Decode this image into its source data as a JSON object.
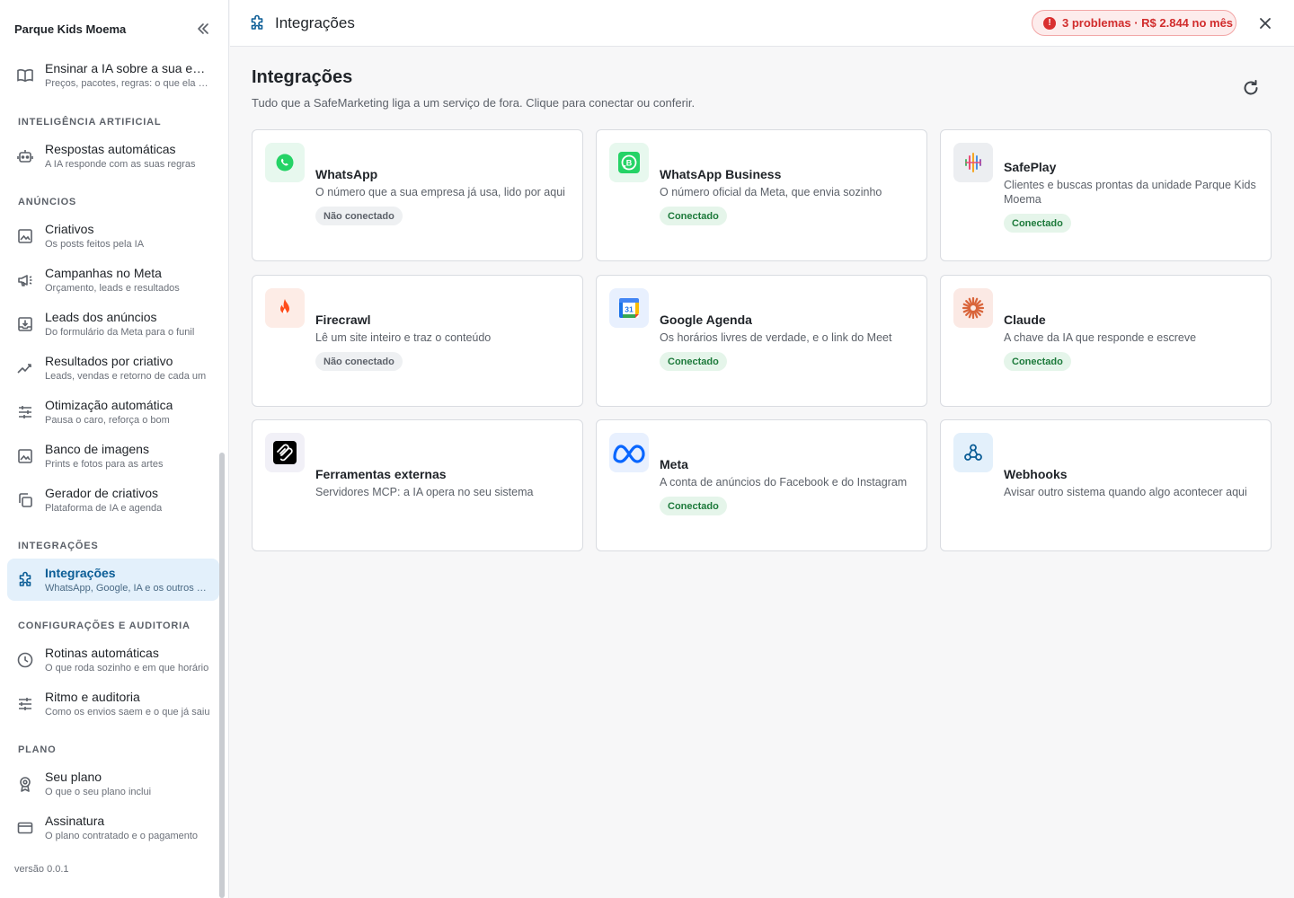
{
  "sidebar": {
    "org_name": "Parque Kids Moema",
    "top_item": {
      "label": "Ensinar a IA sobre a sua empresa",
      "desc": "Preços, pacotes, regras: o que ela precisa saber"
    },
    "sections": [
      {
        "title": "Inteligência artificial"
      },
      {
        "title": "Anúncios"
      },
      {
        "title": "Integrações"
      },
      {
        "title": "Configurações e auditoria"
      },
      {
        "title": "Plano"
      }
    ],
    "items": [
      {
        "label": "Respostas automáticas",
        "desc": "A IA responde com as suas regras"
      },
      {
        "label": "Criativos",
        "desc": "Os posts feitos pela IA"
      },
      {
        "label": "Campanhas no Meta",
        "desc": "Orçamento, leads e resultados"
      },
      {
        "label": "Leads dos anúncios",
        "desc": "Do formulário da Meta para o funil"
      },
      {
        "label": "Resultados por criativo",
        "desc": "Leads, vendas e retorno de cada um"
      },
      {
        "label": "Otimização automática",
        "desc": "Pausa o caro, reforça o bom"
      },
      {
        "label": "Banco de imagens",
        "desc": "Prints e fotos para as artes"
      },
      {
        "label": "Gerador de criativos",
        "desc": "Plataforma de IA e agenda"
      },
      {
        "label": "Integrações",
        "desc": "WhatsApp, Google, IA e os outros serviços"
      },
      {
        "label": "Rotinas automáticas",
        "desc": "O que roda sozinho e em que horário"
      },
      {
        "label": "Ritmo e auditoria",
        "desc": "Como os envios saem e o que já saiu"
      },
      {
        "label": "Seu plano",
        "desc": "O que o seu plano inclui"
      },
      {
        "label": "Assinatura",
        "desc": "O plano contratado e o pagamento"
      }
    ],
    "version": "versão 0.0.1"
  },
  "topbar": {
    "title": "Integrações",
    "problems_label": "3 problemas · R$ 2.844 no mês",
    "problems_icon": "!"
  },
  "main": {
    "title": "Integrações",
    "subtitle": "Tudo que a SafeMarketing liga a um serviço de fora. Clique para conectar ou conferir.",
    "cards": [
      {
        "name": "WhatsApp",
        "desc": "O número que a sua empresa já usa, lido por aqui",
        "status": "Não conectado",
        "icon": "whatsapp-icon"
      },
      {
        "name": "WhatsApp Business",
        "desc": "O número oficial da Meta, que envia sozinho",
        "status": "Conectado",
        "icon": "whatsapp-business-icon"
      },
      {
        "name": "SafePlay",
        "desc": "Clientes e buscas prontas da unidade Parque Kids Moema",
        "status": "Conectado",
        "icon": "safeplay-icon"
      },
      {
        "name": "Firecrawl",
        "desc": "Lê um site inteiro e traz o conteúdo",
        "status": "Não conectado",
        "icon": "fire-icon"
      },
      {
        "name": "Google Agenda",
        "desc": "Os horários livres de verdade, e o link do Meet",
        "status": "Conectado",
        "icon": "google-calendar-icon",
        "calendar_day": "31"
      },
      {
        "name": "Claude",
        "desc": "A chave da IA que responde e escreve",
        "status": "Conectado",
        "icon": "claude-icon"
      },
      {
        "name": "Ferramentas externas",
        "desc": "Servidores MCP: a IA opera no seu sistema",
        "icon": "mcp-icon"
      },
      {
        "name": "Meta",
        "desc": "A conta de anúncios do Facebook e do Instagram",
        "status": "Conectado",
        "icon": "meta-icon"
      },
      {
        "name": "Webhooks",
        "desc": "Avisar outro sistema quando algo acontecer aqui",
        "icon": "webhook-icon"
      }
    ]
  },
  "colors": {
    "accent": "#0b5d96",
    "active_bg": "#e3f0fb",
    "danger": "#d12c2c",
    "success": "#1d7a3b",
    "whatsapp": "#25d366"
  }
}
